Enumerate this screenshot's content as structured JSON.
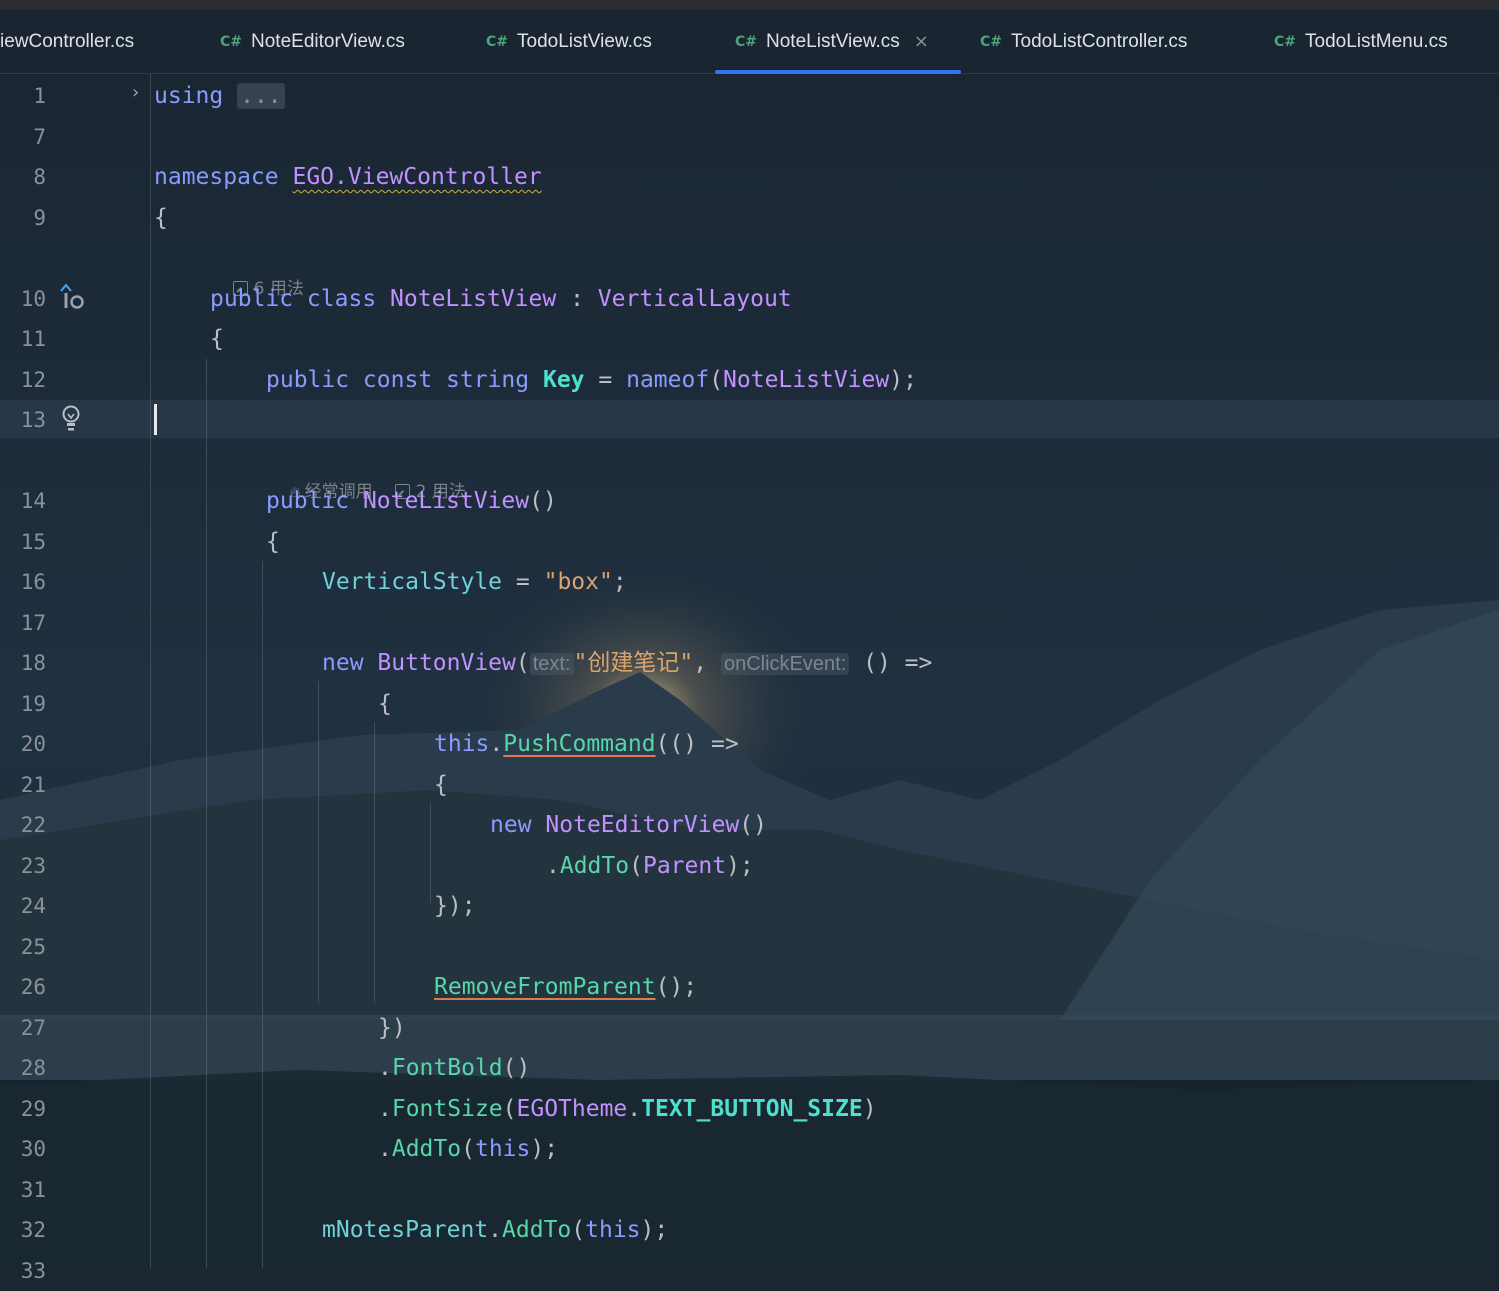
{
  "tabs": [
    {
      "lang": "",
      "label": "iewController.cs",
      "active": false
    },
    {
      "lang": "C#",
      "label": "NoteEditorView.cs",
      "active": false
    },
    {
      "lang": "C#",
      "label": "TodoListView.cs",
      "active": false
    },
    {
      "lang": "C#",
      "label": "NoteListView.cs",
      "active": true,
      "close": "×"
    },
    {
      "lang": "C#",
      "label": "TodoListController.cs",
      "active": false
    },
    {
      "lang": "C#",
      "label": "TodoListMenu.cs",
      "active": false
    }
  ],
  "line_numbers": [
    "1",
    "7",
    "8",
    "9",
    "10",
    "11",
    "12",
    "13",
    "14",
    "15",
    "16",
    "17",
    "18",
    "19",
    "20",
    "21",
    "22",
    "23",
    "24",
    "25",
    "26",
    "27",
    "28",
    "29",
    "30",
    "31",
    "32",
    "33"
  ],
  "hints": {
    "class_usages": "6 用法",
    "ctor_frequent": "经常调用",
    "ctor_usages": "2 用法"
  },
  "code": {
    "l1_kw": "using",
    "l1_fold": "...",
    "l8_kw": "namespace",
    "l8_ns": "EGO.ViewController",
    "l9": "{",
    "l10_kw": "public class",
    "l10_name": "NoteListView",
    "l10_colon": ":",
    "l10_base": "VerticalLayout",
    "l11": "{",
    "l12_kw": "public const string",
    "l12_name": "Key",
    "l12_eq": "=",
    "l12_fn": "nameof",
    "l12_open": "(",
    "l12_arg": "NoteListView",
    "l12_close": ");",
    "l14_kw": "public",
    "l14_name": "NoteListView",
    "l14_paren": "()",
    "l15": "{",
    "l16_prop": "VerticalStyle",
    "l16_eq": "=",
    "l16_str": "\"box\"",
    "l16_end": ";",
    "l18_kw": "new",
    "l18_type": "ButtonView",
    "l18_open": "(",
    "l18_hint_text": "text:",
    "l18_str": "\"创建笔记\"",
    "l18_comma": ",",
    "l18_hint_click": "onClickEvent:",
    "l18_lambda": "() =>",
    "l19": "{",
    "l20_kw": "this",
    "l20_dot": ".",
    "l20_fn": "PushCommand",
    "l20_rest": "(() =>",
    "l21": "{",
    "l22_kw": "new",
    "l22_type": "NoteEditorView",
    "l22_paren": "()",
    "l23_dot": ".",
    "l23_fn": "AddTo",
    "l23_open": "(",
    "l23_arg": "Parent",
    "l23_close": ");",
    "l24": "});",
    "l26_fn": "RemoveFromParent",
    "l26_end": "();",
    "l27": "})",
    "l28_dot": ".",
    "l28_fn": "FontBold",
    "l28_end": "()",
    "l29_dot": ".",
    "l29_fn": "FontSize",
    "l29_open": "(",
    "l29_type": "EGOTheme",
    "l29_dot2": ".",
    "l29_const": "TEXT_BUTTON_SIZE",
    "l29_close": ")",
    "l30_dot": ".",
    "l30_fn": "AddTo",
    "l30_open": "(",
    "l30_kw": "this",
    "l30_close": ");",
    "l32_field": "mNotesParent",
    "l32_dot": ".",
    "l32_fn": "AddTo",
    "l32_open": "(",
    "l32_kw": "this",
    "l32_close": ");"
  },
  "colors": {
    "keyword": "#8a9bff",
    "type": "#c191ff",
    "method": "#57d6a9",
    "string": "#d9a46c",
    "accent": "#3574f0"
  }
}
